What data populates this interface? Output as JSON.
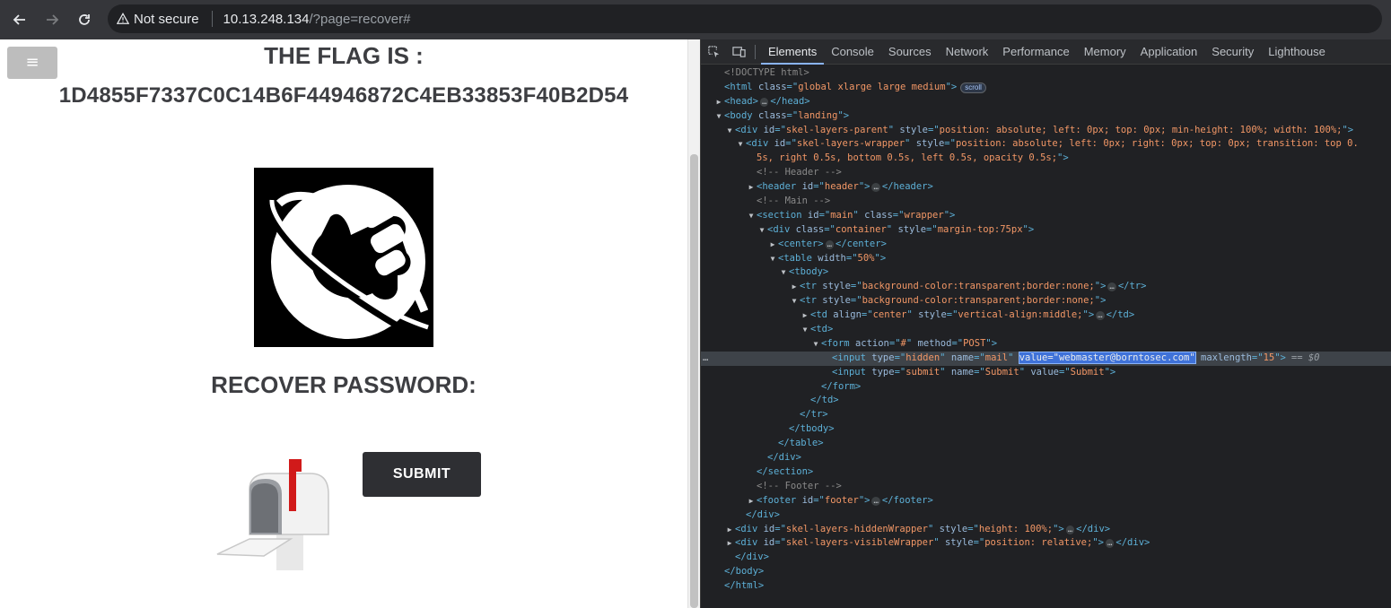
{
  "browser": {
    "security_label": "Not secure",
    "url_host": "10.13.248.134",
    "url_path": "/?page=recover#"
  },
  "page": {
    "menu_icon": "≡",
    "flag_title": "THE FLAG IS :",
    "flag_value": "1D4855F7337C0C14B6F44946872C4EB33853F40B2D54",
    "recover_title": "RECOVER PASSWORD:",
    "submit_label": "SUBMIT"
  },
  "devtools": {
    "tabs": [
      {
        "label": "Elements",
        "active": true
      },
      {
        "label": "Console",
        "active": false
      },
      {
        "label": "Sources",
        "active": false
      },
      {
        "label": "Network",
        "active": false
      },
      {
        "label": "Performance",
        "active": false
      },
      {
        "label": "Memory",
        "active": false
      },
      {
        "label": "Application",
        "active": false
      },
      {
        "label": "Security",
        "active": false
      },
      {
        "label": "Lighthouse",
        "active": false
      }
    ],
    "dom_lines": [
      {
        "indent": 0,
        "tri": "",
        "parts": [
          [
            "cm",
            "<!DOCTYPE html>"
          ]
        ]
      },
      {
        "indent": 0,
        "tri": "",
        "parts": [
          [
            "tag",
            "<html "
          ],
          [
            "an",
            "class"
          ],
          [
            "tag",
            "=\""
          ],
          [
            "av",
            "global xlarge large medium"
          ],
          [
            "tag",
            "\">"
          ]
        ],
        "badge": "scroll"
      },
      {
        "indent": 0,
        "tri": "▶",
        "parts": [
          [
            "tag",
            "<head>"
          ],
          [
            "ell",
            "…"
          ],
          [
            "tag",
            "</head>"
          ]
        ]
      },
      {
        "indent": 0,
        "tri": "▼",
        "parts": [
          [
            "tag",
            "<body "
          ],
          [
            "an",
            "class"
          ],
          [
            "tag",
            "=\""
          ],
          [
            "av",
            "landing"
          ],
          [
            "tag",
            "\">"
          ]
        ]
      },
      {
        "indent": 1,
        "tri": "▼",
        "parts": [
          [
            "tag",
            "<div "
          ],
          [
            "an",
            "id"
          ],
          [
            "tag",
            "=\""
          ],
          [
            "av",
            "skel-layers-parent"
          ],
          [
            "tag",
            "\" "
          ],
          [
            "an",
            "style"
          ],
          [
            "tag",
            "=\""
          ],
          [
            "av",
            "position: absolute; left: 0px; top: 0px; min-height: 100%; width: 100%;"
          ],
          [
            "tag",
            "\">"
          ]
        ]
      },
      {
        "indent": 2,
        "tri": "▼",
        "parts": [
          [
            "tag",
            "<div "
          ],
          [
            "an",
            "id"
          ],
          [
            "tag",
            "=\""
          ],
          [
            "av",
            "skel-layers-wrapper"
          ],
          [
            "tag",
            "\" "
          ],
          [
            "an",
            "style"
          ],
          [
            "tag",
            "=\""
          ],
          [
            "av",
            "position: absolute; left: 0px; right: 0px; top: 0px; transition: top 0."
          ]
        ]
      },
      {
        "indent": 3,
        "tri": "",
        "parts": [
          [
            "av",
            "5s, right 0.5s, bottom 0.5s, left 0.5s, opacity 0.5s;"
          ],
          [
            "tag",
            "\">"
          ]
        ]
      },
      {
        "indent": 3,
        "tri": "",
        "parts": [
          [
            "cm",
            "<!-- Header -->"
          ]
        ]
      },
      {
        "indent": 3,
        "tri": "▶",
        "parts": [
          [
            "tag",
            "<header "
          ],
          [
            "an",
            "id"
          ],
          [
            "tag",
            "=\""
          ],
          [
            "av",
            "header"
          ],
          [
            "tag",
            "\">"
          ],
          [
            "ell",
            "…"
          ],
          [
            "tag",
            "</header>"
          ]
        ]
      },
      {
        "indent": 3,
        "tri": "",
        "parts": [
          [
            "cm",
            "<!-- Main -->"
          ]
        ]
      },
      {
        "indent": 3,
        "tri": "▼",
        "parts": [
          [
            "tag",
            "<section "
          ],
          [
            "an",
            "id"
          ],
          [
            "tag",
            "=\""
          ],
          [
            "av",
            "main"
          ],
          [
            "tag",
            "\" "
          ],
          [
            "an",
            "class"
          ],
          [
            "tag",
            "=\""
          ],
          [
            "av",
            "wrapper"
          ],
          [
            "tag",
            "\">"
          ]
        ]
      },
      {
        "indent": 4,
        "tri": "▼",
        "parts": [
          [
            "tag",
            "<div "
          ],
          [
            "an",
            "class"
          ],
          [
            "tag",
            "=\""
          ],
          [
            "av",
            "container"
          ],
          [
            "tag",
            "\" "
          ],
          [
            "an",
            "style"
          ],
          [
            "tag",
            "=\""
          ],
          [
            "av",
            "margin-top:75px"
          ],
          [
            "tag",
            "\">"
          ]
        ]
      },
      {
        "indent": 5,
        "tri": "▶",
        "parts": [
          [
            "tag",
            "<center>"
          ],
          [
            "ell",
            "…"
          ],
          [
            "tag",
            "</center>"
          ]
        ]
      },
      {
        "indent": 5,
        "tri": "▼",
        "parts": [
          [
            "tag",
            "<table "
          ],
          [
            "an",
            "width"
          ],
          [
            "tag",
            "=\""
          ],
          [
            "av",
            "50%"
          ],
          [
            "tag",
            "\">"
          ]
        ]
      },
      {
        "indent": 6,
        "tri": "▼",
        "parts": [
          [
            "tag",
            "<tbody>"
          ]
        ]
      },
      {
        "indent": 7,
        "tri": "▶",
        "parts": [
          [
            "tag",
            "<tr "
          ],
          [
            "an",
            "style"
          ],
          [
            "tag",
            "=\""
          ],
          [
            "av",
            "background-color:transparent;border:none;"
          ],
          [
            "tag",
            "\">"
          ],
          [
            "ell",
            "…"
          ],
          [
            "tag",
            "</tr>"
          ]
        ]
      },
      {
        "indent": 7,
        "tri": "▼",
        "parts": [
          [
            "tag",
            "<tr "
          ],
          [
            "an",
            "style"
          ],
          [
            "tag",
            "=\""
          ],
          [
            "av",
            "background-color:transparent;border:none;"
          ],
          [
            "tag",
            "\">"
          ]
        ]
      },
      {
        "indent": 8,
        "tri": "▶",
        "parts": [
          [
            "tag",
            "<td "
          ],
          [
            "an",
            "align"
          ],
          [
            "tag",
            "=\""
          ],
          [
            "av",
            "center"
          ],
          [
            "tag",
            "\" "
          ],
          [
            "an",
            "style"
          ],
          [
            "tag",
            "=\""
          ],
          [
            "av",
            "vertical-align:middle;"
          ],
          [
            "tag",
            "\">"
          ],
          [
            "ell",
            "…"
          ],
          [
            "tag",
            "</td>"
          ]
        ]
      },
      {
        "indent": 8,
        "tri": "▼",
        "parts": [
          [
            "tag",
            "<td>"
          ]
        ]
      },
      {
        "indent": 9,
        "tri": "▼",
        "parts": [
          [
            "tag",
            "<form "
          ],
          [
            "an",
            "action"
          ],
          [
            "tag",
            "=\""
          ],
          [
            "av",
            "#"
          ],
          [
            "tag",
            "\" "
          ],
          [
            "an",
            "method"
          ],
          [
            "tag",
            "=\""
          ],
          [
            "av",
            "POST"
          ],
          [
            "tag",
            "\">"
          ]
        ]
      },
      {
        "indent": 10,
        "tri": "",
        "selected": true,
        "parts": [
          [
            "tag",
            "<input "
          ],
          [
            "an",
            "type"
          ],
          [
            "tag",
            "=\""
          ],
          [
            "av",
            "hidden"
          ],
          [
            "tag",
            "\" "
          ],
          [
            "an",
            "name"
          ],
          [
            "tag",
            "=\""
          ],
          [
            "av",
            "mail"
          ],
          [
            "tag",
            "\" "
          ],
          [
            "hl",
            "value=\"webmaster@borntosec.com\""
          ],
          [
            "tag",
            " "
          ],
          [
            "an",
            "maxlength"
          ],
          [
            "tag",
            "=\""
          ],
          [
            "av",
            "15"
          ],
          [
            "tag",
            "\">"
          ]
        ],
        "suffix": "== $0"
      },
      {
        "indent": 10,
        "tri": "",
        "parts": [
          [
            "tag",
            "<input "
          ],
          [
            "an",
            "type"
          ],
          [
            "tag",
            "=\""
          ],
          [
            "av",
            "submit"
          ],
          [
            "tag",
            "\" "
          ],
          [
            "an",
            "name"
          ],
          [
            "tag",
            "=\""
          ],
          [
            "av",
            "Submit"
          ],
          [
            "tag",
            "\" "
          ],
          [
            "an",
            "value"
          ],
          [
            "tag",
            "=\""
          ],
          [
            "av",
            "Submit"
          ],
          [
            "tag",
            "\">"
          ]
        ]
      },
      {
        "indent": 9,
        "tri": "",
        "parts": [
          [
            "tag",
            "</form>"
          ]
        ]
      },
      {
        "indent": 8,
        "tri": "",
        "parts": [
          [
            "tag",
            "</td>"
          ]
        ]
      },
      {
        "indent": 7,
        "tri": "",
        "parts": [
          [
            "tag",
            "</tr>"
          ]
        ]
      },
      {
        "indent": 6,
        "tri": "",
        "parts": [
          [
            "tag",
            "</tbody>"
          ]
        ]
      },
      {
        "indent": 5,
        "tri": "",
        "parts": [
          [
            "tag",
            "</table>"
          ]
        ]
      },
      {
        "indent": 4,
        "tri": "",
        "parts": [
          [
            "tag",
            "</div>"
          ]
        ]
      },
      {
        "indent": 3,
        "tri": "",
        "parts": [
          [
            "tag",
            "</section>"
          ]
        ]
      },
      {
        "indent": 3,
        "tri": "",
        "parts": [
          [
            "cm",
            "<!-- Footer -->"
          ]
        ]
      },
      {
        "indent": 3,
        "tri": "▶",
        "parts": [
          [
            "tag",
            "<footer "
          ],
          [
            "an",
            "id"
          ],
          [
            "tag",
            "=\""
          ],
          [
            "av",
            "footer"
          ],
          [
            "tag",
            "\">"
          ],
          [
            "ell",
            "…"
          ],
          [
            "tag",
            "</footer>"
          ]
        ]
      },
      {
        "indent": 2,
        "tri": "",
        "parts": [
          [
            "tag",
            "</div>"
          ]
        ]
      },
      {
        "indent": 1,
        "tri": "▶",
        "parts": [
          [
            "tag",
            "<div "
          ],
          [
            "an",
            "id"
          ],
          [
            "tag",
            "=\""
          ],
          [
            "av",
            "skel-layers-hiddenWrapper"
          ],
          [
            "tag",
            "\" "
          ],
          [
            "an",
            "style"
          ],
          [
            "tag",
            "=\""
          ],
          [
            "av",
            "height: 100%;"
          ],
          [
            "tag",
            "\">"
          ],
          [
            "ell",
            "…"
          ],
          [
            "tag",
            "</div>"
          ]
        ]
      },
      {
        "indent": 1,
        "tri": "▶",
        "parts": [
          [
            "tag",
            "<div "
          ],
          [
            "an",
            "id"
          ],
          [
            "tag",
            "=\""
          ],
          [
            "av",
            "skel-layers-visibleWrapper"
          ],
          [
            "tag",
            "\" "
          ],
          [
            "an",
            "style"
          ],
          [
            "tag",
            "=\""
          ],
          [
            "av",
            "position: relative;"
          ],
          [
            "tag",
            "\">"
          ],
          [
            "ell",
            "…"
          ],
          [
            "tag",
            "</div>"
          ]
        ]
      },
      {
        "indent": 1,
        "tri": "",
        "parts": [
          [
            "tag",
            "</div>"
          ]
        ]
      },
      {
        "indent": 0,
        "tri": "",
        "parts": [
          [
            "tag",
            "</body>"
          ]
        ]
      },
      {
        "indent": 0,
        "tri": "",
        "parts": [
          [
            "tag",
            "</html>"
          ]
        ]
      }
    ],
    "gutter_icon": "…"
  },
  "colors": {
    "accent": "#8ab4f8",
    "page_text": "#3d3e42",
    "button_bg": "#2e2f33"
  },
  "icons": {
    "back": "back-arrow-icon",
    "forward": "forward-arrow-icon",
    "reload": "reload-icon",
    "warning": "warning-icon",
    "inspect": "inspect-element-icon",
    "device": "device-toolbar-icon",
    "logo": "thumbs-planet-logo",
    "mailbox": "mailbox-icon"
  }
}
